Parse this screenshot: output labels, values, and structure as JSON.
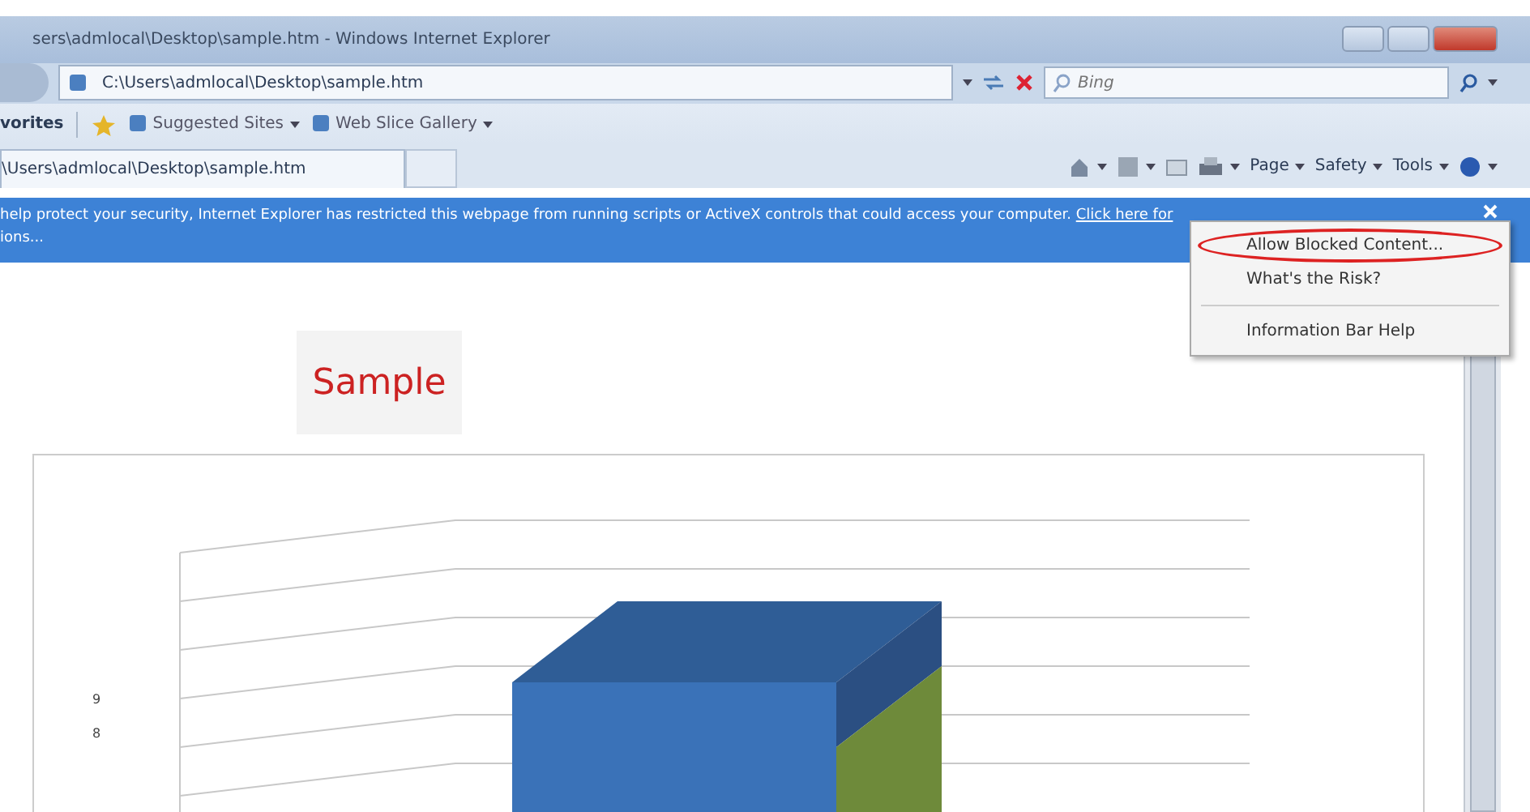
{
  "window": {
    "title": "sers\\admlocal\\Desktop\\sample.htm - Windows Internet Explorer"
  },
  "address_bar": {
    "value": "C:\\Users\\admlocal\\Desktop\\sample.htm"
  },
  "search": {
    "placeholder": "Bing"
  },
  "favorites_bar": {
    "label": "vorites",
    "links": [
      "Suggested Sites",
      "Web Slice Gallery"
    ]
  },
  "tabs": [
    {
      "label": "\\Users\\admlocal\\Desktop\\sample.htm",
      "selected": true
    }
  ],
  "command_bar": {
    "menus": [
      "Page",
      "Safety",
      "Tools"
    ]
  },
  "info_bar": {
    "text": "help protect your security, Internet Explorer has restricted this webpage from running scripts or ActiveX controls that could access your computer.",
    "link": "Click here for",
    "continuation": "ions..."
  },
  "info_menu": {
    "items": [
      {
        "label": "Allow Blocked Content...",
        "selected": true
      },
      {
        "label": "What's the Risk?",
        "selected": false
      },
      {
        "label": "Information Bar Help",
        "selected": false
      }
    ]
  },
  "page": {
    "heading": "Sample",
    "chart": {
      "y_tick_labels": [
        "9",
        "8"
      ]
    }
  }
}
